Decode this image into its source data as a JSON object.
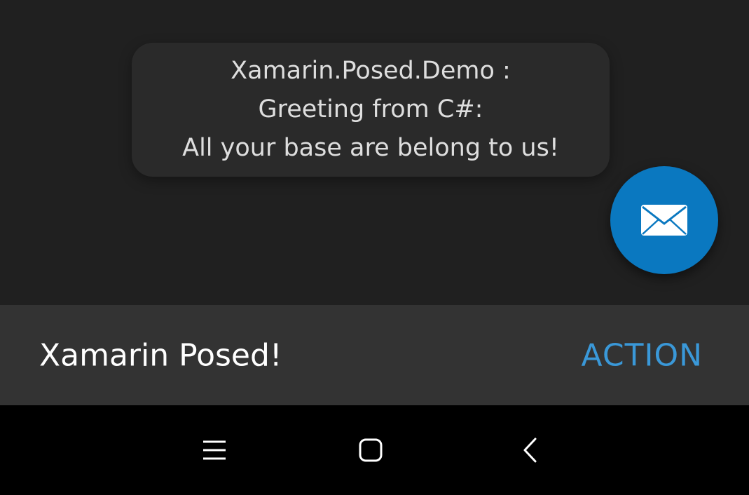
{
  "toast": {
    "lines": [
      "Xamarin.Posed.Demo :",
      "Greeting from C#:",
      "All your base are belong to us!"
    ]
  },
  "fab": {
    "icon": "mail-icon",
    "color": "#0a78c0"
  },
  "snackbar": {
    "message": "Xamarin Posed!",
    "action_label": "ACTION",
    "action_color": "#3a98d8"
  },
  "navbar": {
    "buttons": [
      {
        "icon": "menu-icon"
      },
      {
        "icon": "home-icon"
      },
      {
        "icon": "back-icon"
      }
    ]
  }
}
